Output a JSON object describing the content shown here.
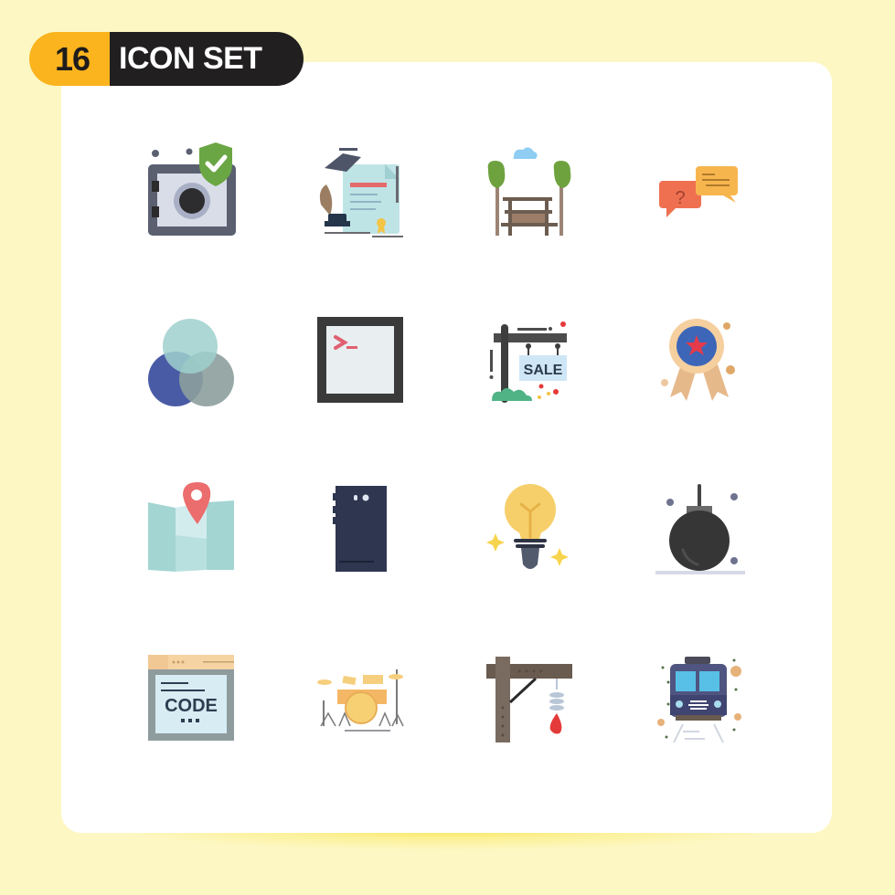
{
  "header": {
    "count": "16",
    "title": "ICON SET"
  },
  "colors": {
    "background": "#fdf7c4",
    "card": "#ffffff",
    "badge_accent": "#fbb41d",
    "badge_dark": "#211f1f"
  },
  "icons": [
    {
      "name": "safe-protected",
      "row": 1,
      "col": 1
    },
    {
      "name": "graduation-certificate",
      "row": 1,
      "col": 2
    },
    {
      "name": "park-bench",
      "row": 1,
      "col": 3
    },
    {
      "name": "chat-question",
      "row": 1,
      "col": 4
    },
    {
      "name": "venn-circles",
      "row": 2,
      "col": 1
    },
    {
      "name": "terminal-window",
      "row": 2,
      "col": 2,
      "text": ">_"
    },
    {
      "name": "sale-sign",
      "row": 2,
      "col": 3,
      "text": "SALE"
    },
    {
      "name": "award-ribbon",
      "row": 2,
      "col": 4
    },
    {
      "name": "map-location",
      "row": 3,
      "col": 1
    },
    {
      "name": "smartphone-back",
      "row": 3,
      "col": 2
    },
    {
      "name": "light-bulb-idea",
      "row": 3,
      "col": 3
    },
    {
      "name": "wrecking-ball",
      "row": 3,
      "col": 4
    },
    {
      "name": "code-browser",
      "row": 4,
      "col": 1,
      "text": "CODE"
    },
    {
      "name": "drum-kit",
      "row": 4,
      "col": 2
    },
    {
      "name": "gallows-noose",
      "row": 4,
      "col": 3
    },
    {
      "name": "train-front",
      "row": 4,
      "col": 4
    }
  ]
}
